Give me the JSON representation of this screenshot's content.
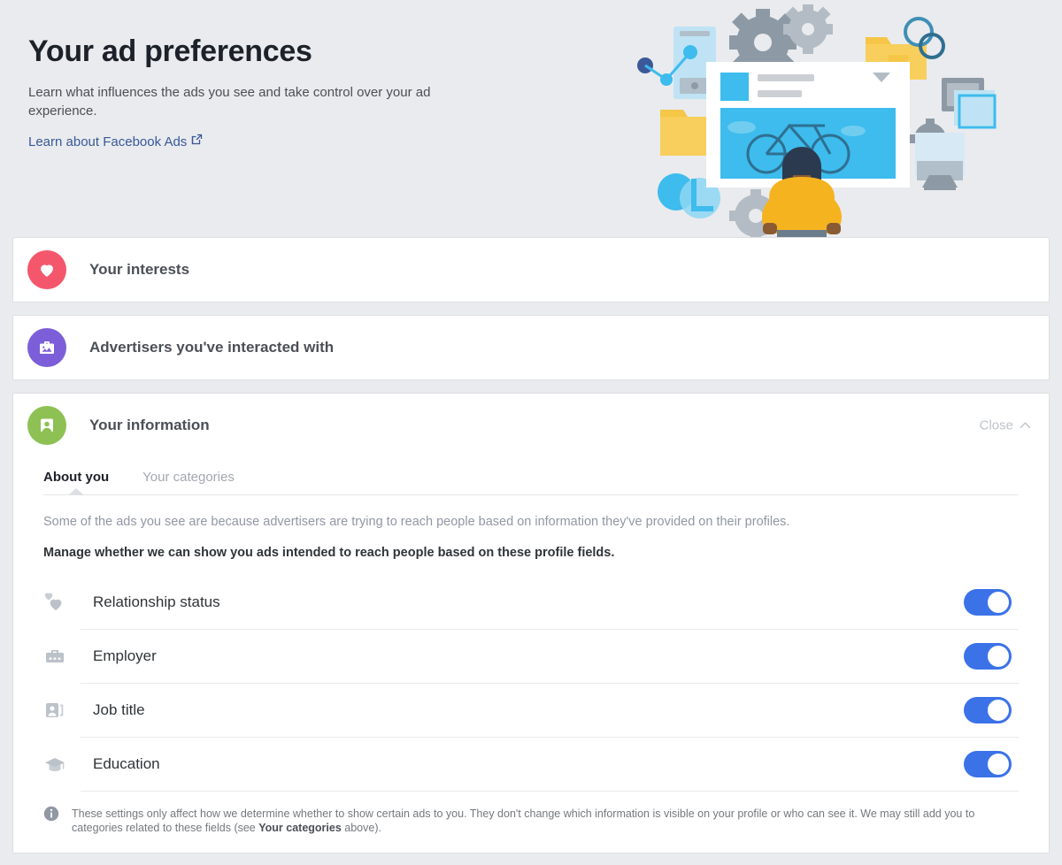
{
  "header": {
    "title": "Your ad preferences",
    "subtitle": "Learn what influences the ads you see and take control over your ad experience.",
    "learn_link": "Learn about Facebook Ads",
    "external_link_icon": "external-link-icon"
  },
  "sections": [
    {
      "label": "Your interests",
      "icon": "heart-icon",
      "color": "#f4576c"
    },
    {
      "label": "Advertisers you've interacted with",
      "icon": "briefcase-image-icon",
      "color": "#7d5ed9"
    }
  ],
  "info_section": {
    "label": "Your information",
    "icon": "profile-card-icon",
    "color": "#8dc153",
    "close_label": "Close",
    "close_icon": "chevron-up-icon",
    "tabs": [
      {
        "label": "About you",
        "active": true
      },
      {
        "label": "Your categories",
        "active": false
      }
    ],
    "intro_note": "Some of the ads you see are because advertisers are trying to reach people based on information they've provided on their profiles.",
    "manage_note": "Manage whether we can show you ads intended to reach people based on these profile fields.",
    "fields": [
      {
        "label": "Relationship status",
        "icon": "hearts-icon",
        "enabled": true
      },
      {
        "label": "Employer",
        "icon": "briefcase-icon",
        "enabled": true
      },
      {
        "label": "Job title",
        "icon": "id-badge-icon",
        "enabled": true
      },
      {
        "label": "Education",
        "icon": "graduation-cap-icon",
        "enabled": true
      }
    ],
    "footer": {
      "icon": "info-icon",
      "part1": "These settings only affect how we determine whether to show certain ads to you. They don't change which information is visible on your profile or who can see it. We may still add you to categories related to these fields (see ",
      "bold": "Your categories",
      "part2": " above)."
    }
  },
  "colors": {
    "page_bg": "#e9ebee",
    "card_bg": "#ffffff",
    "toggle_on": "#3b72e8",
    "link": "#385898"
  }
}
